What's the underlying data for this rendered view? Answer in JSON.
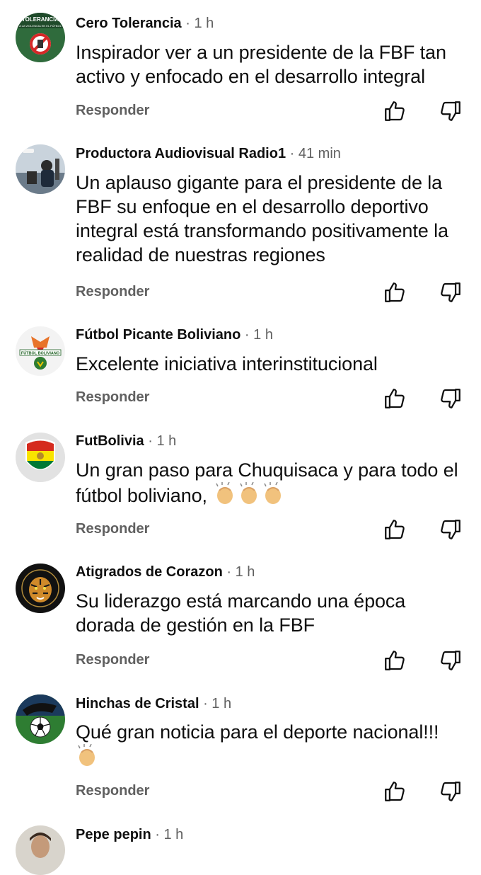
{
  "reply_label": "Responder",
  "colors": {
    "author": "#0f0f0f",
    "secondary": "#606060",
    "text": "#0f0f0f"
  },
  "comments": [
    {
      "author": "Cero Tolerancia",
      "time": "· 1 h",
      "text": "Inspirador ver a un presidente de la FBF tan activo y enfocado en el desarrollo integral",
      "avatar_text": "TOLERANCIA",
      "avatar_subtext": "A LA VIOLENCIA EN EL FÚTBOL",
      "avatar_icon": "no-violence-logo"
    },
    {
      "author": "Productora Audiovisual Radio1",
      "time": "· 41 min",
      "text": "Un aplauso gigante para el presidente de la FBF su enfoque en el desarrollo deportivo integral está transformando positivamente la realidad de nuestras regiones",
      "avatar_icon": "studio-photo"
    },
    {
      "author": "Fútbol Picante Boliviano",
      "time": "· 1 h",
      "text": "Excelente iniciativa interinstitucional",
      "avatar_text": "FÚTBOL BOLIVIANO",
      "avatar_icon": "chili-logo"
    },
    {
      "author": "FutBolivia",
      "time": "· 1 h",
      "text": "Un gran paso para Chuquisaca y para todo el fútbol boliviano,",
      "avatar_icon": "bolivia-flag-shield",
      "emoji": "👏",
      "emoji_count": 3
    },
    {
      "author": "Atigrados de Corazon",
      "time": "· 1 h",
      "text": "Su liderazgo está marcando una época dorada de gestión en la FBF",
      "avatar_icon": "tiger-logo"
    },
    {
      "author": "Hinchas de Cristal",
      "time": "· 1 h",
      "text": "Qué gran noticia para el deporte nacional!!!",
      "avatar_icon": "soccer-ball",
      "emoji": "👏",
      "emoji_count": 1
    },
    {
      "author": "Pepe pepin",
      "time": "· 1 h",
      "text": "",
      "avatar_icon": "person-photo"
    }
  ]
}
